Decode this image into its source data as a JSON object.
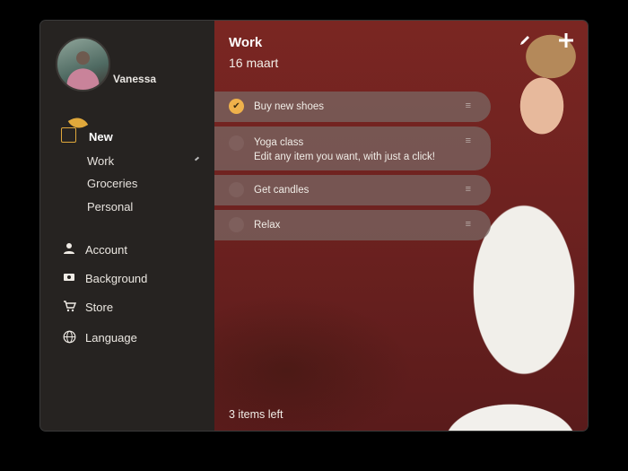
{
  "sidebar": {
    "username": "Vanessa",
    "new_label": "New",
    "lists": [
      "Work",
      "Groceries",
      "Personal"
    ],
    "menu": [
      {
        "label": "Account",
        "icon": "person-icon"
      },
      {
        "label": "Background",
        "icon": "ticket-icon"
      },
      {
        "label": "Store",
        "icon": "cart-icon"
      },
      {
        "label": "Language",
        "icon": "globe-icon"
      }
    ]
  },
  "main": {
    "title": "Work",
    "date": "16 maart",
    "todos": [
      {
        "text": "Buy new shoes",
        "done": true
      },
      {
        "text": "Yoga class",
        "sub": "Edit any item you want, with just a click!",
        "done": false
      },
      {
        "text": "Get candles",
        "done": false
      },
      {
        "text": "Relax",
        "done": false
      }
    ],
    "footer": "3 items left"
  },
  "colors": {
    "accent": "#efb14b",
    "sidebar_bg": "#262321",
    "todo_bg": "#786460"
  }
}
